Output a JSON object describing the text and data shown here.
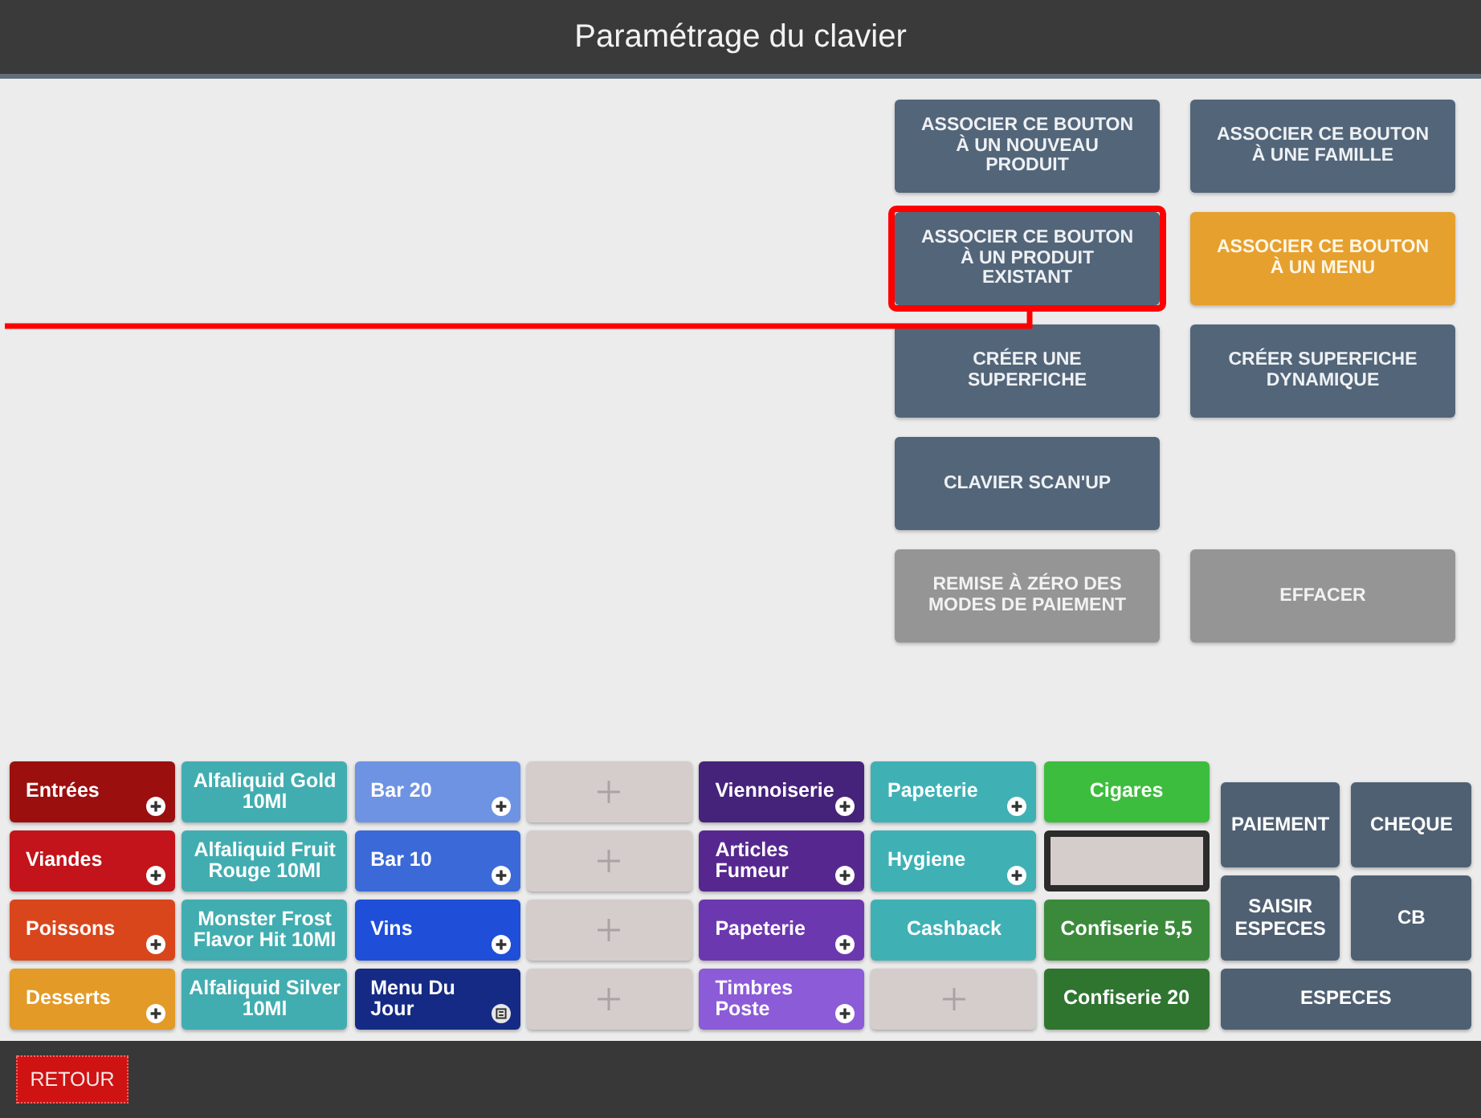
{
  "header": {
    "title": "Paramétrage du clavier"
  },
  "actions": {
    "rows": [
      [
        {
          "label": "ASSOCIER CE BOUTON À UN NOUVEAU PRODUIT",
          "selected": false,
          "disabled": false,
          "highlighted": false
        },
        {
          "label": "ASSOCIER CE BOUTON À UNE FAMILLE",
          "selected": false,
          "disabled": false,
          "highlighted": false
        }
      ],
      [
        {
          "label": "ASSOCIER CE BOUTON À UN PRODUIT EXISTANT",
          "selected": false,
          "disabled": false,
          "highlighted": true
        },
        {
          "label": "ASSOCIER CE BOUTON À UN MENU",
          "selected": true,
          "disabled": false,
          "highlighted": false
        }
      ],
      [
        {
          "label": "CRÉER UNE SUPERFICHE",
          "selected": false,
          "disabled": false,
          "highlighted": false
        },
        {
          "label": "CRÉER SUPERFICHE DYNAMIQUE",
          "selected": false,
          "disabled": false,
          "highlighted": false
        }
      ],
      [
        {
          "label": "CLAVIER SCAN'UP",
          "selected": false,
          "disabled": false,
          "highlighted": false
        }
      ],
      [
        {
          "label": "REMISE À ZÉRO DES MODES DE PAIEMENT",
          "selected": false,
          "disabled": true,
          "highlighted": false
        },
        {
          "label": "EFFACER",
          "selected": false,
          "disabled": true,
          "highlighted": false
        }
      ]
    ]
  },
  "keyboard": {
    "rows": [
      [
        {
          "kind": "family",
          "label": "Entrées",
          "color": "#9b0f0f",
          "selected": false
        },
        {
          "kind": "product",
          "label": "Alfaliquid Gold 10Ml",
          "color": "#42adb0",
          "selected": false
        },
        {
          "kind": "family",
          "label": "Bar 20",
          "color": "#6e93e3",
          "selected": false
        },
        {
          "kind": "empty",
          "selected": false
        },
        {
          "kind": "family",
          "label": "Viennoiserie",
          "color": "#45237a",
          "selected": false
        },
        {
          "kind": "family",
          "label": "Papeterie",
          "color": "#3fb1b5",
          "selected": false
        },
        {
          "kind": "product",
          "label": "Cigares",
          "color": "#3dbd3d",
          "selected": false
        }
      ],
      [
        {
          "kind": "family",
          "label": "Viandes",
          "color": "#c2141a",
          "selected": false
        },
        {
          "kind": "product",
          "label": "Alfaliquid Fruit Rouge 10Ml",
          "color": "#42adb0",
          "selected": false
        },
        {
          "kind": "family",
          "label": "Bar 10",
          "color": "#3b6ad8",
          "selected": false
        },
        {
          "kind": "empty",
          "selected": false
        },
        {
          "kind": "family",
          "label": "Articles Fumeur",
          "color": "#56288f",
          "selected": false
        },
        {
          "kind": "family",
          "label": "Hygiene",
          "color": "#3fb1b5",
          "selected": false
        },
        {
          "kind": "empty",
          "selected": true
        }
      ],
      [
        {
          "kind": "family",
          "label": "Poissons",
          "color": "#d9461c",
          "selected": false
        },
        {
          "kind": "product",
          "label": "Monster Frost Flavor Hit 10Ml",
          "color": "#42adb0",
          "selected": false
        },
        {
          "kind": "family",
          "label": "Vins",
          "color": "#1f4ed8",
          "selected": false
        },
        {
          "kind": "empty",
          "selected": false
        },
        {
          "kind": "family",
          "label": "Papeterie",
          "color": "#6c38b0",
          "selected": false
        },
        {
          "kind": "product",
          "label": "Cashback",
          "color": "#3fb1b5",
          "selected": false
        },
        {
          "kind": "product",
          "label": "Confiserie 5,5",
          "color": "#3b8a3b",
          "selected": false
        }
      ],
      [
        {
          "kind": "family",
          "label": "Desserts",
          "color": "#e39a26",
          "selected": false
        },
        {
          "kind": "product",
          "label": "Alfaliquid Silver 10Ml",
          "color": "#42adb0",
          "selected": false
        },
        {
          "kind": "menu",
          "label": "Menu Du Jour",
          "color": "#152a85",
          "selected": false
        },
        {
          "kind": "empty",
          "selected": false
        },
        {
          "kind": "family",
          "label": "Timbres Poste",
          "color": "#8c5bd8",
          "selected": false
        },
        {
          "kind": "empty",
          "selected": false
        },
        {
          "kind": "product",
          "label": "Confiserie 20",
          "color": "#2f7530",
          "selected": false
        }
      ]
    ]
  },
  "payment": {
    "rows": [
      [
        {
          "label": "PAIEMENT"
        },
        {
          "label": "CHEQUE"
        }
      ],
      [
        {
          "label": "SAISIR ESPECES"
        },
        {
          "label": "CB"
        }
      ],
      [
        {
          "label": "ESPECES"
        }
      ]
    ]
  },
  "footer": {
    "back_button": "RETOUR"
  }
}
